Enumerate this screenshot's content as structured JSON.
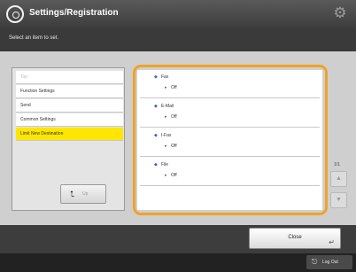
{
  "header": {
    "title": "Settings/Registration",
    "title_icon": "settings-registration-icon",
    "gear_icon": "gear-icon"
  },
  "hint": "Select an item to set.",
  "tree": {
    "items": [
      {
        "label": "Top",
        "state": "dim"
      },
      {
        "label": "Function Settings",
        "state": "normal"
      },
      {
        "label": "Send",
        "state": "normal"
      },
      {
        "label": "Common Settings",
        "state": "normal"
      },
      {
        "label": "Limit New Destination",
        "state": "selected"
      }
    ],
    "up_label": "Up"
  },
  "list": {
    "items": [
      {
        "name": "Fax",
        "value": "Off"
      },
      {
        "name": "E-Mail",
        "value": "Off"
      },
      {
        "name": "I-Fax",
        "value": "Off"
      },
      {
        "name": "File",
        "value": "Off"
      }
    ]
  },
  "pager": {
    "count": "1/1"
  },
  "buttons": {
    "close": "Close",
    "logout": "Log Out"
  },
  "colors": {
    "accent": "#f1a226",
    "selected": "#ffe600",
    "bullet": "#3c64c8"
  }
}
